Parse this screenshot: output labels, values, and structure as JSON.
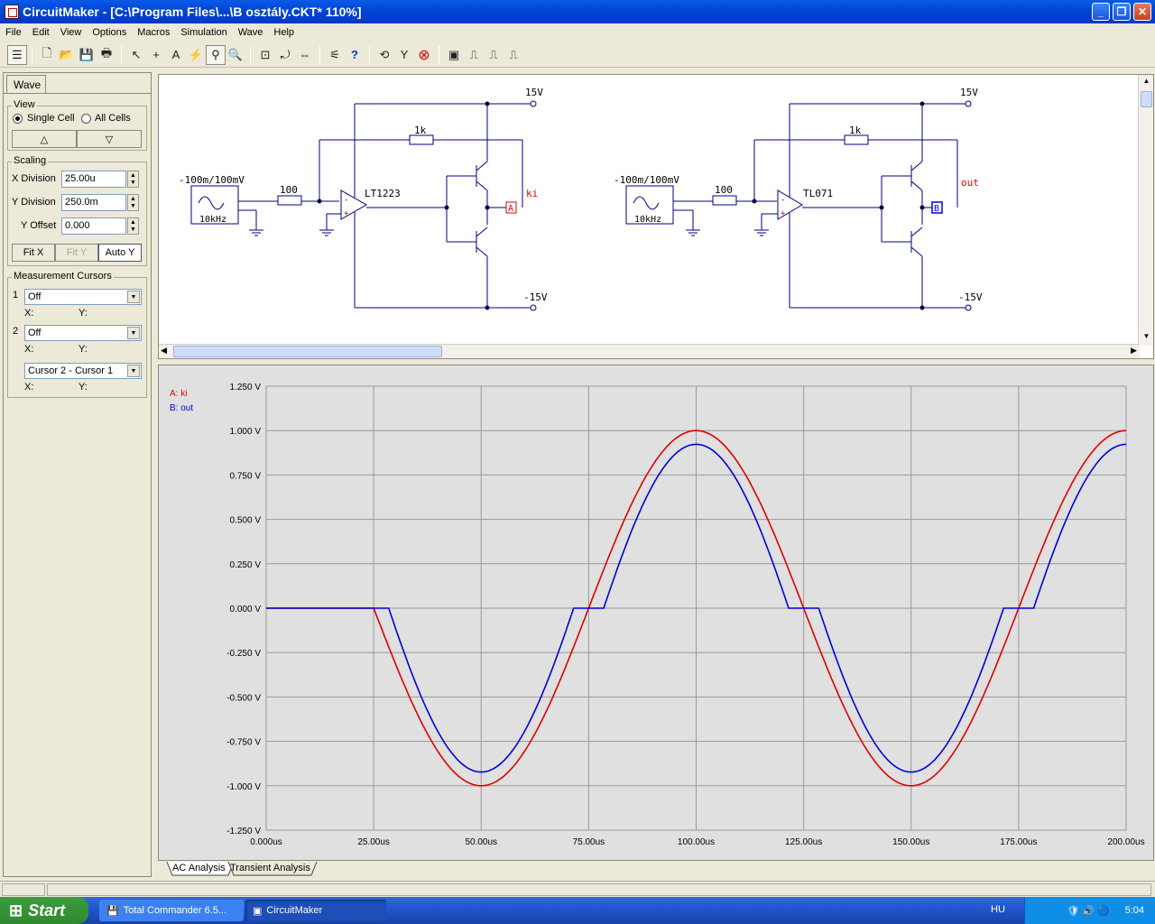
{
  "window": {
    "title": "CircuitMaker - [C:\\Program Files\\...\\B osztály.CKT* 110%]"
  },
  "menu": [
    "File",
    "Edit",
    "View",
    "Options",
    "Macros",
    "Simulation",
    "Wave",
    "Help"
  ],
  "left_panel": {
    "tab": "Wave",
    "view": {
      "title": "View",
      "single_cell": "Single Cell",
      "all_cells": "All Cells",
      "up_btn": "△",
      "down_btn": "▽"
    },
    "scaling": {
      "title": "Scaling",
      "x_div_label": "X Division",
      "x_div_value": "25.00u",
      "y_div_label": "Y Division",
      "y_div_value": "250.0m",
      "y_off_label": "Y Offset",
      "y_off_value": "0.000",
      "fit_x": "Fit X",
      "fit_y": "Fit Y",
      "auto_y": "Auto Y"
    },
    "cursors": {
      "title": "Measurement Cursors",
      "c1_num": "1",
      "c1_value": "Off",
      "c2_num": "2",
      "c2_value": "Off",
      "diff_value": "Cursor 2 - Cursor 1",
      "x_label": "X:",
      "y_label": "Y:"
    }
  },
  "schematic": {
    "left": {
      "source": "-100m/100mV",
      "freq": "10kHz",
      "r_in": "100",
      "r_fb": "1k",
      "opamp": "LT1223",
      "vplus": "15V",
      "vminus": "-15V",
      "probe_letter": "A",
      "probe_name": "ki",
      "minus": "-",
      "plus": "+"
    },
    "right": {
      "source": "-100m/100mV",
      "freq": "10kHz",
      "r_in": "100",
      "r_fb": "1k",
      "opamp": "TL071",
      "vplus": "15V",
      "vminus": "-15V",
      "probe_letter": "B",
      "probe_name": "out",
      "minus": "-",
      "plus": "+"
    }
  },
  "tabs": {
    "ac": "AC Analysis",
    "transient": "Transient Analysis"
  },
  "taskbar": {
    "start": "Start",
    "task1": "Total Commander 6.5...",
    "task2": "CircuitMaker",
    "lang": "HU",
    "time": "5:04"
  },
  "colors": {
    "red": "#e00000",
    "blue": "#0000e0",
    "wire": "#000080"
  },
  "chart_data": {
    "type": "line",
    "y_ticks": [
      "1.250 V",
      "1.000 V",
      "0.750 V",
      "0.500 V",
      "0.250 V",
      "0.000 V",
      "-0.250 V",
      "-0.500 V",
      "-0.750 V",
      "-1.000 V",
      "-1.250 V"
    ],
    "x_ticks": [
      "0.000us",
      "25.00us",
      "50.00us",
      "75.00us",
      "100.00us",
      "125.00us",
      "150.00us",
      "175.00us",
      "200.00us"
    ],
    "xlim": [
      0,
      200
    ],
    "ylim": [
      -1.25,
      1.25
    ],
    "grid": true,
    "legend": "top-left",
    "series": [
      {
        "name": "A: ki",
        "color": "#e00000",
        "period_us": 100,
        "amplitude": 1.0,
        "start_us": 25,
        "deadzone_us": 0
      },
      {
        "name": "B: out",
        "color": "#0000e0",
        "period_us": 100,
        "amplitude": 1.0,
        "start_us": 25,
        "deadzone_us": 3.5
      }
    ]
  }
}
